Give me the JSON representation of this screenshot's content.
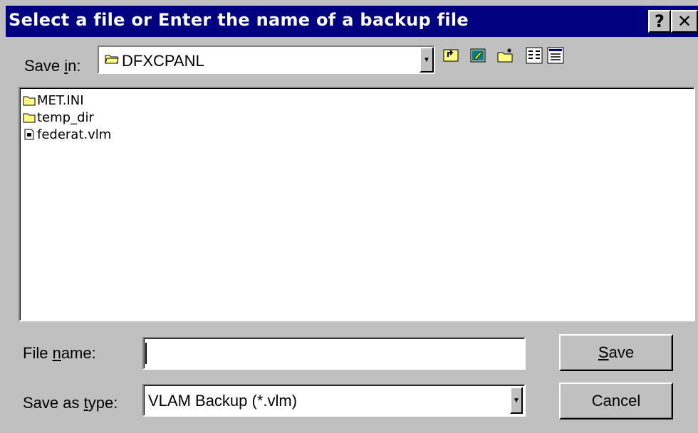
{
  "window": {
    "title": "Select a file or Enter the name of a backup file",
    "help_glyph": "?",
    "close_glyph": "✕"
  },
  "save_in": {
    "label_prefix": "Save ",
    "label_accel": "i",
    "label_suffix": "n:",
    "value": "DFXCPANL",
    "icon": "folder-open-icon",
    "arrow": "▼"
  },
  "toolbar": {
    "items": [
      "up-one-level-icon",
      "go-to-desktop-icon",
      "create-new-folder-icon",
      "list-view-icon",
      "details-view-icon"
    ]
  },
  "files": [
    {
      "name": "MET.INI",
      "icon": "folder-icon"
    },
    {
      "name": "temp_dir",
      "icon": "folder-icon"
    },
    {
      "name": "federat.vlm",
      "icon": "file-icon"
    }
  ],
  "filename": {
    "label_prefix": "File ",
    "label_accel": "n",
    "label_suffix": "ame:",
    "value": ""
  },
  "filetype": {
    "label_prefix": "Save as ",
    "label_accel": "t",
    "label_suffix": "ype:",
    "value": "VLAM Backup (*.vlm)",
    "arrow": "▼"
  },
  "buttons": {
    "save_accel": "S",
    "save_rest": "ave",
    "cancel": "Cancel"
  },
  "colors": {
    "titlebar": "#000080",
    "face": "#c0c0c0",
    "folder": "#ffff80"
  }
}
